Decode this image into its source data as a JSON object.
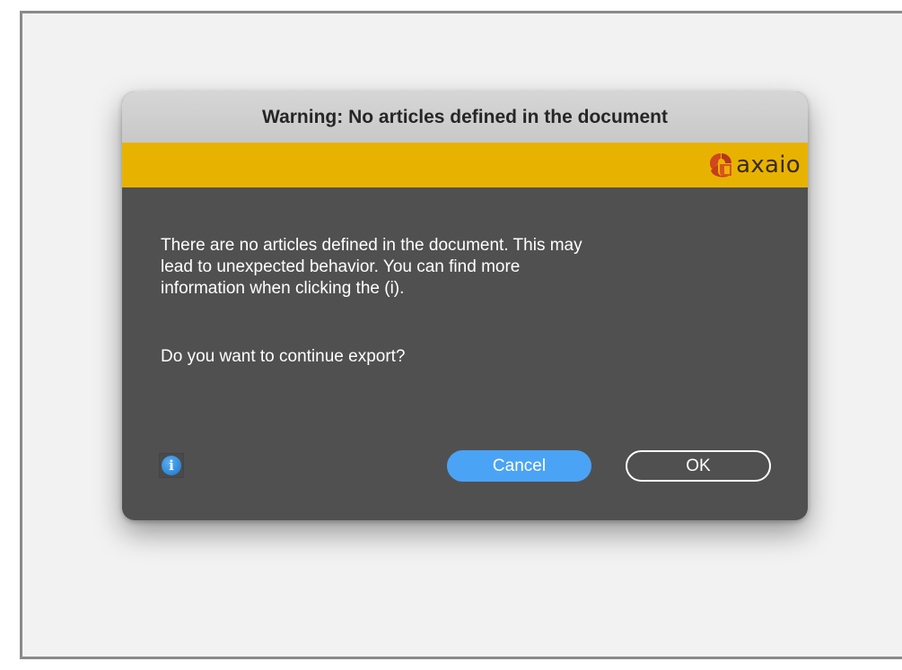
{
  "dialog": {
    "title": "Warning: No articles defined in the document",
    "brand": {
      "name": "axaio",
      "bar_color": "#e8b300"
    },
    "message": "There are no articles defined in the document. This may\nlead to unexpected behavior. You can find more\ninformation when clicking the (i).",
    "question": "Do you want to continue export?",
    "info_button": {
      "glyph": "i",
      "icon": "info-icon"
    },
    "buttons": {
      "cancel_label": "Cancel",
      "ok_label": "OK"
    },
    "colors": {
      "body": "#505050",
      "titlebar": "#cfcfcf",
      "accent": "#4aa3f5"
    }
  }
}
